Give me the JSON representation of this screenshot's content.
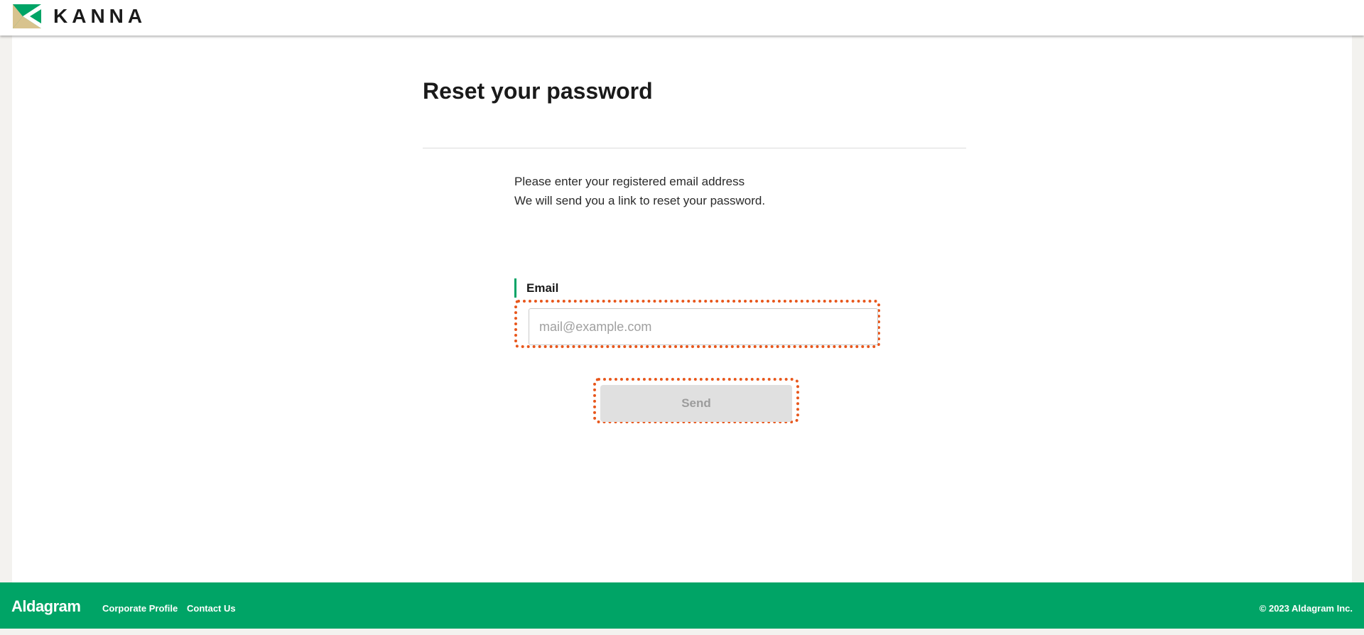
{
  "header": {
    "logo_text": "KANNA",
    "logo_colors": {
      "green": "#00a466",
      "tan": "#d8c38e"
    }
  },
  "main": {
    "title": "Reset your password",
    "description": [
      "Please enter your registered email address",
      "We will send you a link to reset your password."
    ],
    "email_label": "Email",
    "email_value": "",
    "email_placeholder": "mail@example.com",
    "send_label": "Send"
  },
  "footer": {
    "brand": "Aldagram",
    "links": [
      "Corporate Profile",
      "Contact Us"
    ],
    "copyright": "© 2023 Aldagram Inc."
  },
  "colors": {
    "accent": "#00a466",
    "focus_outline": "#e8571c",
    "disabled_button_bg": "#e0e0e0",
    "disabled_button_text": "#9c9c9c"
  }
}
